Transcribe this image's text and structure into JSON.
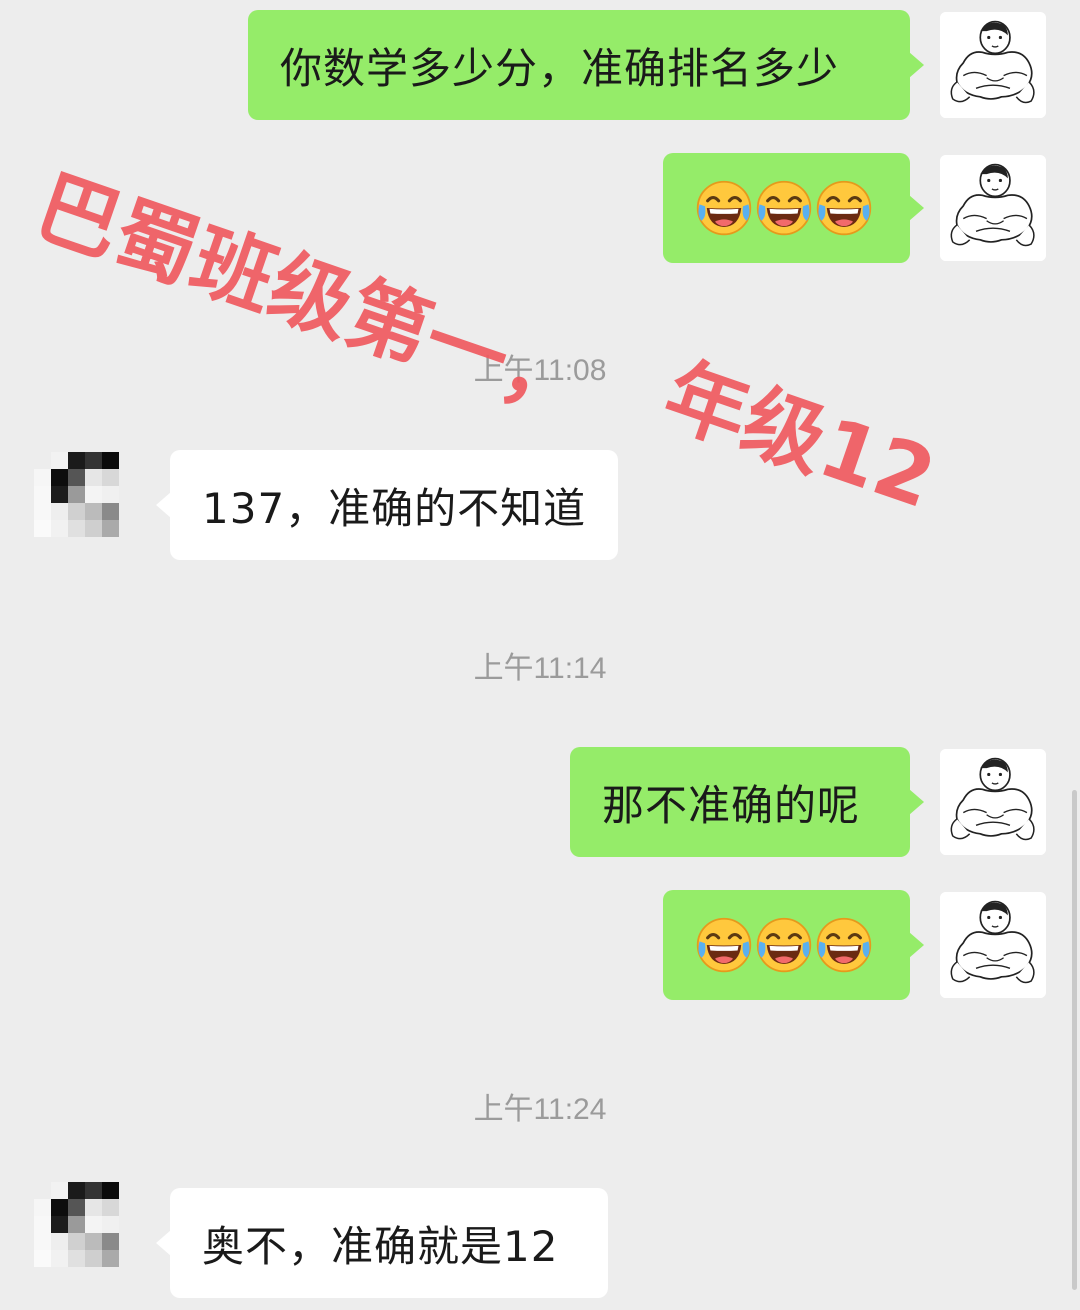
{
  "messages": {
    "m1": "你数学多少分，准确排名多少",
    "m2_emoji": "face-with-tears-of-joy x3",
    "m3": "137，准确的不知道",
    "m4": "那不准确的呢",
    "m5_emoji": "face-with-tears-of-joy x3",
    "m6": "奥不，准确就是12"
  },
  "timestamps": {
    "t1": "上午11:08",
    "t2": "上午11:14",
    "t3": "上午11:24"
  },
  "overlay": {
    "line1": "巴蜀班级第一，",
    "line2": "年级12"
  },
  "colors": {
    "background": "#ededed",
    "outgoing_bubble": "#95ec69",
    "incoming_bubble": "#ffffff",
    "overlay_text": "#f05a5f",
    "timestamp_text": "#9b9b9b"
  }
}
